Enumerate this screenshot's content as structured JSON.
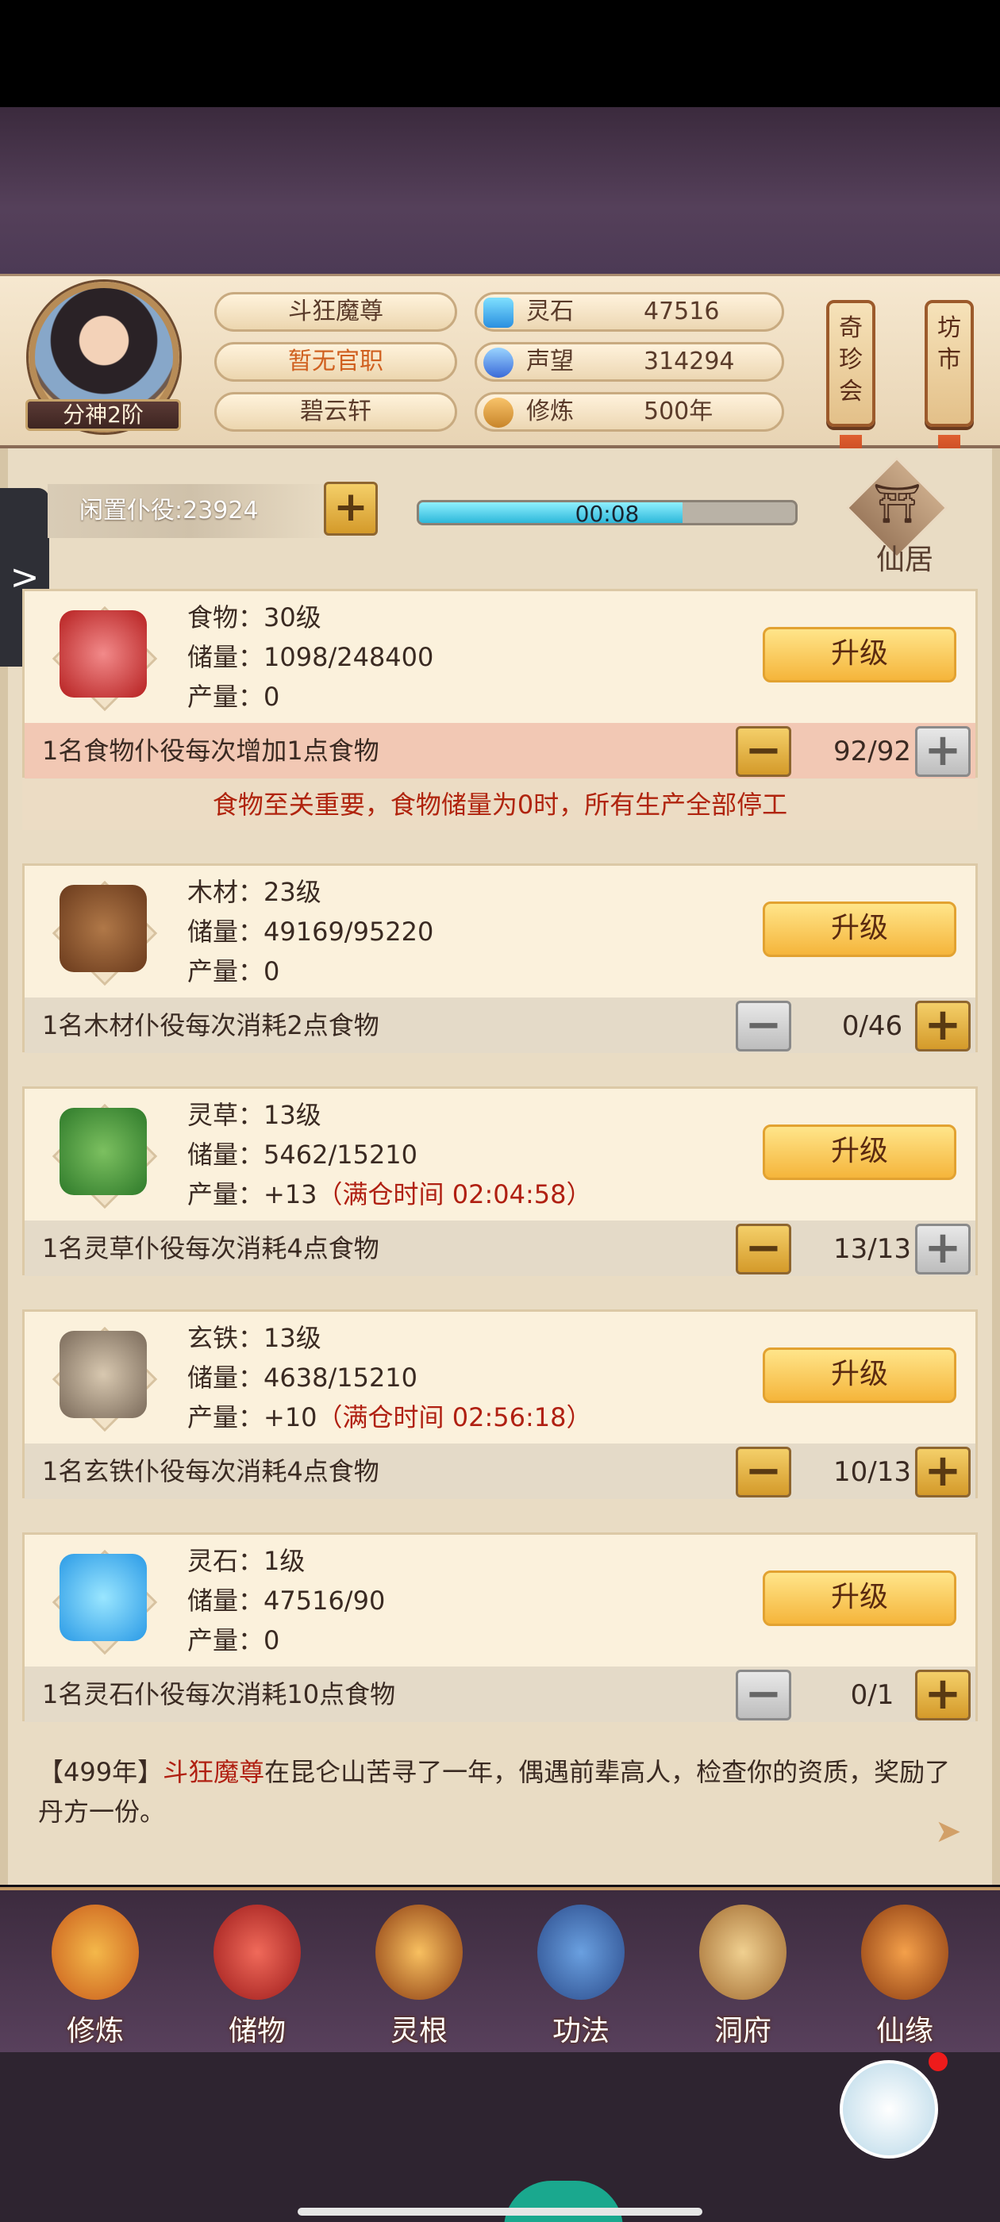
{
  "header": {
    "name": "斗狂魔尊",
    "official": "暂无官职",
    "sect": "碧云轩",
    "rank": "分神2阶",
    "stats": [
      {
        "label": "灵石",
        "value": "47516"
      },
      {
        "label": "声望",
        "value": "314294"
      },
      {
        "label": "修炼",
        "value": "500年"
      }
    ],
    "banners": [
      {
        "label": "奇珍会"
      },
      {
        "label": "坊市"
      }
    ]
  },
  "workers": {
    "idle": "闲置仆役:23924",
    "timer": "00:08",
    "timer_progress": 0.7
  },
  "house": "仙居",
  "warning": "食物至关重要，食物储量为0时，所有生产全部停工",
  "upgrade_label": "升级",
  "resources": [
    {
      "name": "食物：30级",
      "storage": "储量：1098/248400",
      "output": "产量：0",
      "output_extra": "",
      "desc": "1名食物仆役每次增加1点食物",
      "count": "92/92"
    },
    {
      "name": "木材：23级",
      "storage": "储量：49169/95220",
      "output": "产量：0",
      "output_extra": "",
      "desc": "1名木材仆役每次消耗2点食物",
      "count": "0/46"
    },
    {
      "name": "灵草：13级",
      "storage": "储量：5462/15210",
      "output": "产量：+13",
      "output_extra": "（满仓时间 02:04:58）",
      "desc": "1名灵草仆役每次消耗4点食物",
      "count": "13/13"
    },
    {
      "name": "玄铁：13级",
      "storage": "储量：4638/15210",
      "output": "产量：+10",
      "output_extra": "（满仓时间 02:56:18）",
      "desc": "1名玄铁仆役每次消耗4点食物",
      "count": "10/13"
    },
    {
      "name": "灵石：1级",
      "storage": "储量：47516/90",
      "output": "产量：0",
      "output_extra": "",
      "desc": "1名灵石仆役每次消耗10点食物",
      "count": "0/1"
    }
  ],
  "log": {
    "year": "【499年】",
    "who": "斗狂魔尊",
    "text": "在昆仑山苦寻了一年，偶遇前辈高人，检查你的资质，奖励了丹方一份。"
  },
  "nav": [
    {
      "label": "修炼"
    },
    {
      "label": "储物"
    },
    {
      "label": "灵根"
    },
    {
      "label": "功法"
    },
    {
      "label": "洞府"
    },
    {
      "label": "仙缘"
    }
  ],
  "side_tab": ">",
  "plus": "+",
  "minus": "−"
}
